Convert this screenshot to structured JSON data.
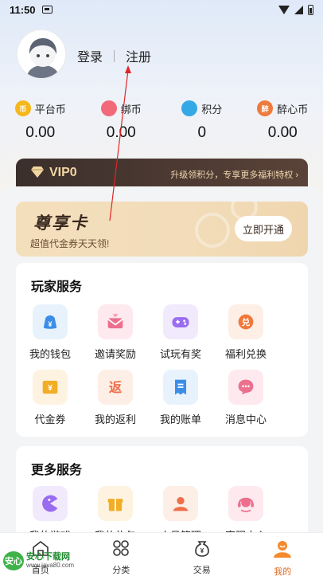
{
  "status_bar": {
    "time": "11:50"
  },
  "auth": {
    "login": "登录",
    "register": "注册"
  },
  "wallet": [
    {
      "icon": "platform-coin-icon",
      "label": "平台币",
      "value": "0.00",
      "color": "#f5b81c",
      "glyph": "币"
    },
    {
      "icon": "bind-coin-icon",
      "label": "绑币",
      "value": "0.00",
      "color": "#f26a7a",
      "glyph": ""
    },
    {
      "icon": "points-icon",
      "label": "积分",
      "value": "0",
      "color": "#35a8e6",
      "glyph": ""
    },
    {
      "icon": "zuixin-coin-icon",
      "label": "醉心币",
      "value": "0.00",
      "color": "#f07a3c",
      "glyph": "醉"
    }
  ],
  "vip_bar": {
    "level": "VIP0",
    "tip": "升级领积分，专享更多福利特权"
  },
  "vip_card": {
    "title": "尊享卡",
    "subtitle": "超值代金券天天领!",
    "button": "立即开通"
  },
  "player_services": {
    "title": "玩家服务",
    "items": [
      {
        "icon": "wallet-icon",
        "label": "我的钱包",
        "bg": "#e8f2fc",
        "fg": "#3b8ee8"
      },
      {
        "icon": "invite-envelope-icon",
        "label": "邀请奖励",
        "bg": "#fde9ee",
        "fg": "#ec6f8e"
      },
      {
        "icon": "gamepad-icon",
        "label": "试玩有奖",
        "bg": "#f1eafd",
        "fg": "#9a6cf0"
      },
      {
        "icon": "exchange-icon",
        "label": "福利兑换",
        "bg": "#fdeee6",
        "fg": "#f2773a"
      },
      {
        "icon": "voucher-icon",
        "label": "代金券",
        "bg": "#fdf3e0",
        "fg": "#f2ad26"
      },
      {
        "icon": "rebate-icon",
        "label": "我的返利",
        "bg": "#fdeee6",
        "fg": "#ef6f4b"
      },
      {
        "icon": "bill-icon",
        "label": "我的账单",
        "bg": "#e8f2fc",
        "fg": "#3b8ee8"
      },
      {
        "icon": "message-icon",
        "label": "消息中心",
        "bg": "#fde9ee",
        "fg": "#ec6f8e"
      }
    ]
  },
  "more_services": {
    "title": "更多服务",
    "items": [
      {
        "icon": "my-games-icon",
        "label": "我的游戏",
        "bg": "#f1eafd",
        "fg": "#9a6cf0"
      },
      {
        "icon": "gift-icon",
        "label": "我的礼包",
        "bg": "#fdf3e0",
        "fg": "#f2ad26"
      },
      {
        "icon": "account-manage-icon",
        "label": "小号管理",
        "bg": "#fdeee6",
        "fg": "#ef6f4b"
      },
      {
        "icon": "customer-service-icon",
        "label": "客服中心",
        "bg": "#fde9ee",
        "fg": "#ec6f8e"
      }
    ]
  },
  "tabbar": [
    {
      "icon": "home-icon",
      "label": "首页",
      "active": false
    },
    {
      "icon": "category-icon",
      "label": "分类",
      "active": false
    },
    {
      "icon": "trade-icon",
      "label": "交易",
      "active": false
    },
    {
      "icon": "profile-icon",
      "label": "我的",
      "active": true
    }
  ],
  "watermark": {
    "logo": "安心",
    "title": "安心下载网",
    "url": "www.java80.com"
  },
  "accent_color": "#e06a1e"
}
